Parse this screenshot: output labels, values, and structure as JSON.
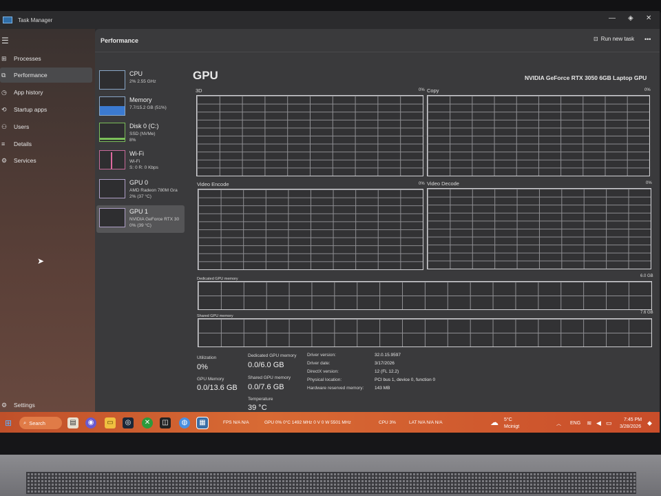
{
  "window": {
    "title": "Task Manager"
  },
  "nav": {
    "items": [
      {
        "label": "Processes",
        "icon": "processes-icon"
      },
      {
        "label": "Performance",
        "icon": "performance-icon"
      },
      {
        "label": "App history",
        "icon": "app-history-icon"
      },
      {
        "label": "Startup apps",
        "icon": "startup-apps-icon"
      },
      {
        "label": "Users",
        "icon": "users-icon"
      },
      {
        "label": "Details",
        "icon": "details-icon"
      },
      {
        "label": "Services",
        "icon": "services-icon"
      }
    ],
    "settings_label": "Settings",
    "active": "Performance"
  },
  "header": {
    "title": "Performance",
    "run_new_task": "Run new task",
    "more": "•••"
  },
  "devices": [
    {
      "name": "CPU",
      "line1": "2% 2.55 GHz",
      "line2": ""
    },
    {
      "name": "Memory",
      "line1": "7.7/15.2 GB (51%)",
      "line2": ""
    },
    {
      "name": "Disk 0 (C:)",
      "line1": "SSD (NVMe)",
      "line2": "8%"
    },
    {
      "name": "Wi-Fi",
      "line1": "Wi-Fi",
      "line2": "S: 0 R: 0 Kbps"
    },
    {
      "name": "GPU 0",
      "line1": "AMD Radeon 780M Gra",
      "line2": "2% (37 °C)"
    },
    {
      "name": "GPU 1",
      "line1": "NVIDIA GeForce RTX 30",
      "line2": "0% (39 °C)"
    }
  ],
  "gpu": {
    "title": "GPU",
    "model": "NVIDIA GeForce RTX 3050 6GB Laptop GPU",
    "engines": [
      {
        "label": "3D",
        "pct": "0%"
      },
      {
        "label": "Copy",
        "pct": "0%"
      },
      {
        "label": "Video Encode",
        "pct": "0%"
      },
      {
        "label": "Video Decode",
        "pct": "0%"
      }
    ],
    "dedicated_label": "Dedicated GPU memory",
    "dedicated_max": "6.0 GB",
    "shared_label": "Shared GPU memory",
    "shared_max": "7.6 GB"
  },
  "stats": {
    "utilization": {
      "label": "Utilization",
      "value": "0%"
    },
    "dedicated": {
      "label": "Dedicated GPU memory",
      "value": "0.0/6.0 GB"
    },
    "gpu_memory": {
      "label": "GPU Memory",
      "value": "0.0/13.6 GB"
    },
    "shared": {
      "label": "Shared GPU memory",
      "value": "0.0/7.6 GB"
    },
    "temperature": {
      "label": "Temperature",
      "value": "39 °C"
    }
  },
  "details": [
    {
      "key": "Driver version:",
      "value": "32.0.15.9597"
    },
    {
      "key": "Driver date:",
      "value": "3/17/2026"
    },
    {
      "key": "DirectX version:",
      "value": "12 (FL 12.2)"
    },
    {
      "key": "Physical location:",
      "value": "PCI bus 1, device 0, function 0"
    },
    {
      "key": "Hardware reserved memory:",
      "value": "143 MB"
    }
  ],
  "taskbar": {
    "search_label": "Search",
    "osd": [
      "FPS  N/A  N/A",
      "GPU  0%  0°C  1492 MHz  0 V  0 W  5501 MHz",
      "CPU  3%",
      "LAT  N/A  N/A  N/A"
    ],
    "weather_temp": "5°C",
    "weather_desc": "Mcinigt",
    "lang": "ENG",
    "time": "7:45 PM",
    "date": "3/28/2026"
  }
}
